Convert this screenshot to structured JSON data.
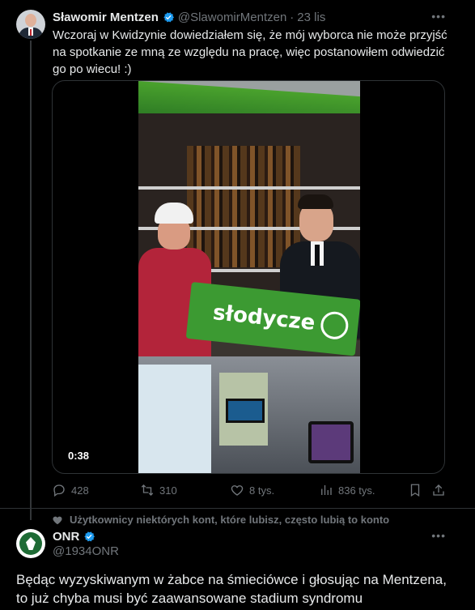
{
  "tweet1": {
    "author_name": "Sławomir Mentzen",
    "author_handle": "@SlawomirMentzen",
    "separator": "·",
    "time": "23 lis",
    "text": "Wczoraj w Kwidzynie dowiedziałem się, że mój wyborca nie może przyjść na spotkanie ze mną ze względu na pracę, więc postanowiłem odwiedzić go po wiecu! :)",
    "media": {
      "duration": "0:38",
      "sign_text": "słodycze"
    },
    "actions": {
      "replies": "428",
      "reposts": "310",
      "likes": "8 tys.",
      "views": "836 tys."
    }
  },
  "social_context": "Użytkownicy niektórych kont, które lubisz, często lubią to konto",
  "tweet2": {
    "author_name": "ONR",
    "author_handle": "@1934ONR",
    "text": "Będąc wyzyskiwanym w żabce na śmieciówce i głosując na Mentzena, to już chyba musi być zaawansowane stadium syndromu sztokholmskiego."
  },
  "colors": {
    "background": "#000000",
    "text": "#e7e9ea",
    "muted": "#71767b",
    "verified": "#1d9bf0",
    "border": "#2f3336"
  }
}
